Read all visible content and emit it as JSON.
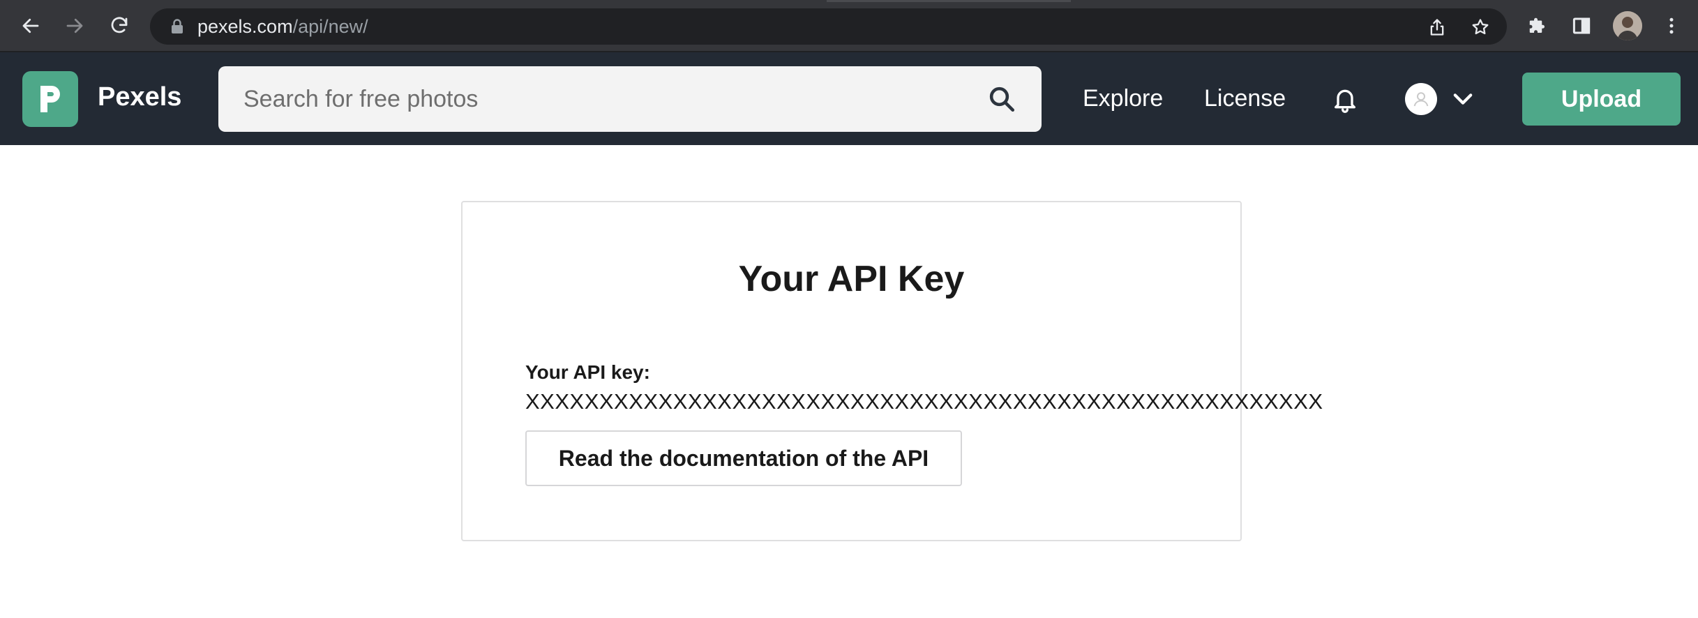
{
  "browser": {
    "url_host": "pexels.com",
    "url_path": "/api/new/"
  },
  "header": {
    "logo_text": "Pexels",
    "search_placeholder": "Search for free photos",
    "nav": {
      "explore": "Explore",
      "license": "License"
    },
    "upload_label": "Upload",
    "colors": {
      "header_bg": "#232a34",
      "brand": "#4ea889"
    },
    "icons": [
      "search-icon",
      "bell-icon",
      "user-avatar-icon",
      "chevron-down-icon"
    ]
  },
  "main": {
    "title": "Your API Key",
    "key_label": "Your API key:",
    "key_value": "XXXXXXXXXXXXXXXXXXXXXXXXXXXXXXXXXXXXXXXXXXXXXXXXXXXXXX",
    "docs_button_label": "Read the documentation of the API"
  }
}
